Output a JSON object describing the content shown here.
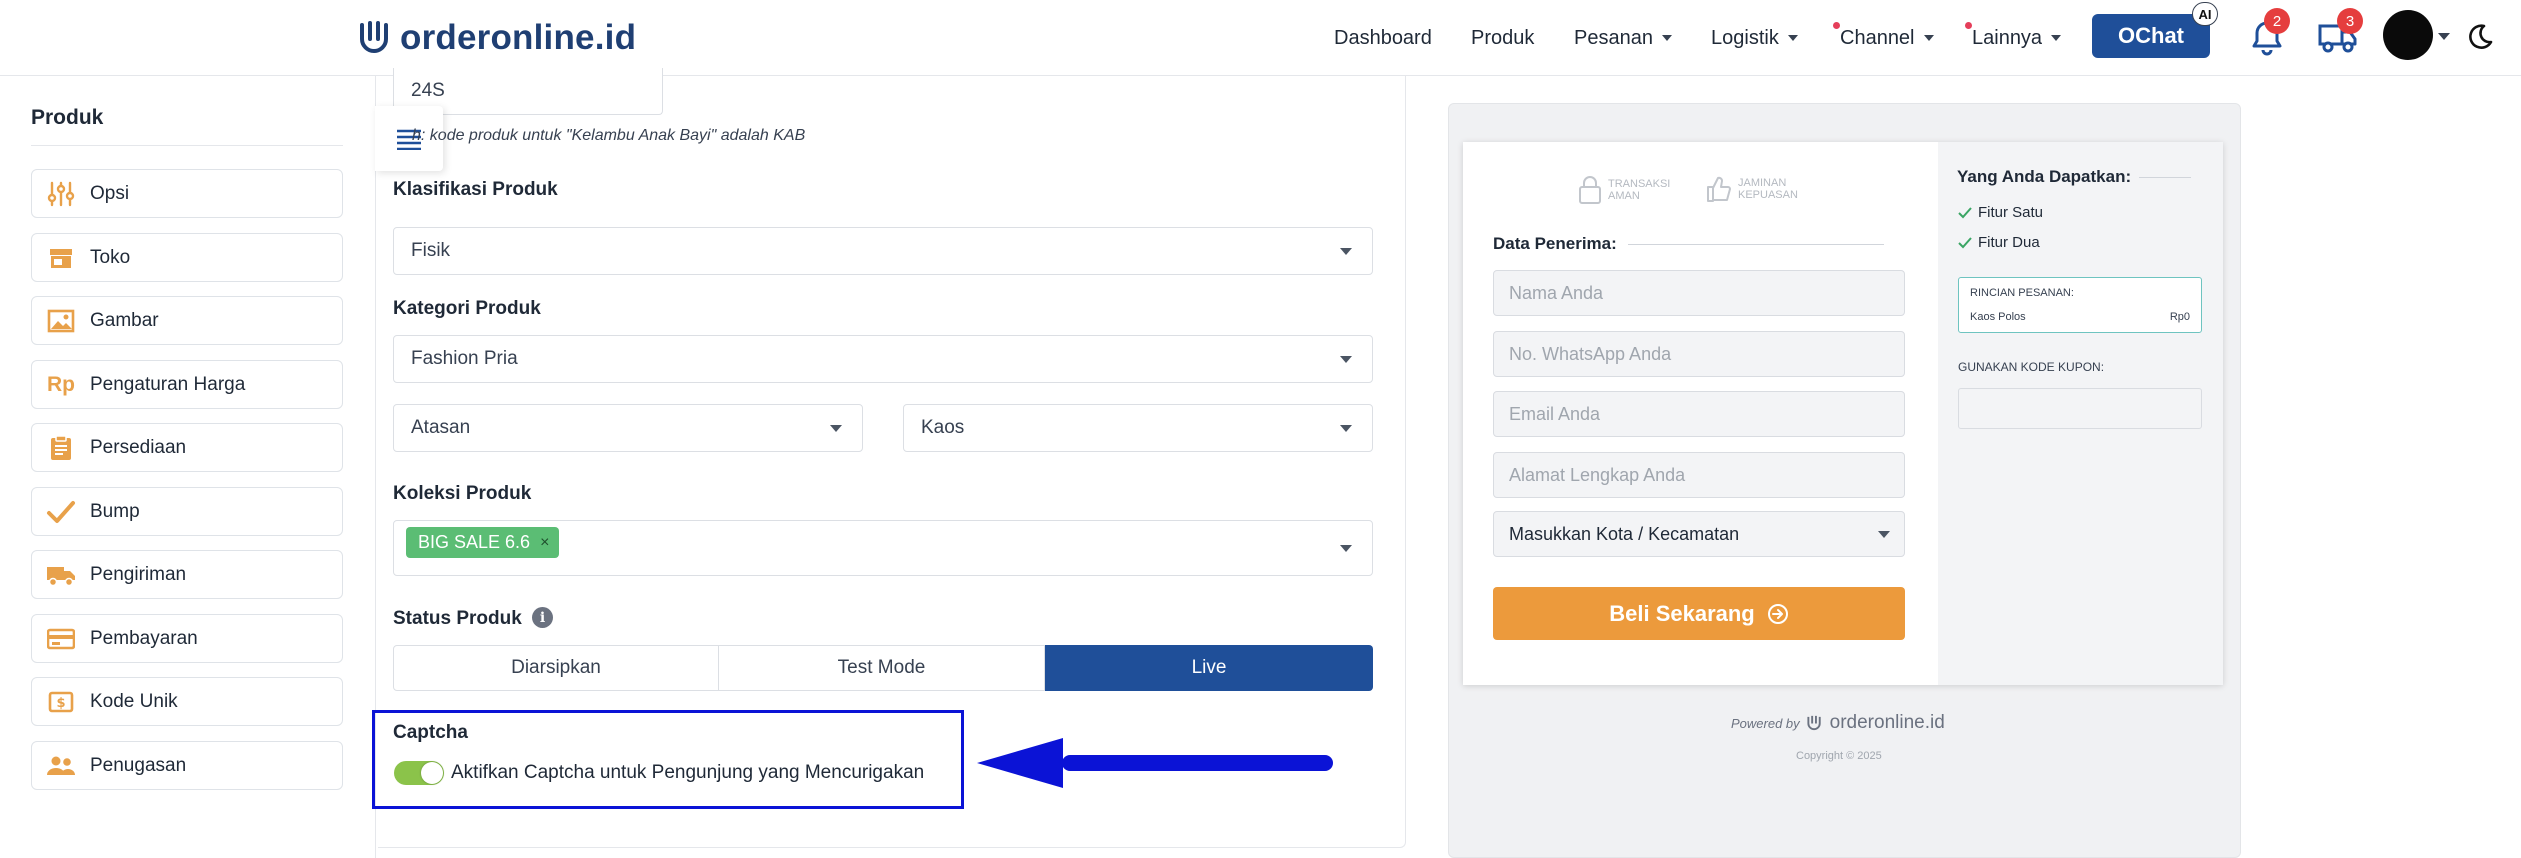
{
  "header": {
    "logo_text": "orderonline.id",
    "nav": [
      "Dashboard",
      "Produk",
      "Pesanan",
      "Logistik",
      "Channel",
      "Lainnya"
    ],
    "ochat_label": "OChat",
    "ai_label": "AI",
    "notif_count": "2",
    "shipping_count": "3"
  },
  "sidebar": {
    "title": "Produk",
    "items": [
      {
        "label": "Opsi",
        "icon": "sliders-icon"
      },
      {
        "label": "Toko",
        "icon": "store-icon"
      },
      {
        "label": "Gambar",
        "icon": "image-icon"
      },
      {
        "label": "Pengaturan Harga",
        "icon": "rp-icon"
      },
      {
        "label": "Persediaan",
        "icon": "clipboard-icon"
      },
      {
        "label": "Bump",
        "icon": "check-icon"
      },
      {
        "label": "Pengiriman",
        "icon": "truck-icon"
      },
      {
        "label": "Pembayaran",
        "icon": "card-icon"
      },
      {
        "label": "Kode Unik",
        "icon": "dollar-box-icon"
      },
      {
        "label": "Penugasan",
        "icon": "users-icon"
      }
    ]
  },
  "form": {
    "code_value": "24S",
    "code_hint": "h: kode produk untuk \"Kelambu Anak Bayi\" adalah KAB",
    "klasifikasi_label": "Klasifikasi Produk",
    "klasifikasi_value": "Fisik",
    "kategori_label": "Kategori Produk",
    "kategori_value": "Fashion Pria",
    "sub1_value": "Atasan",
    "sub2_value": "Kaos",
    "koleksi_label": "Koleksi Produk",
    "koleksi_tag": "BIG SALE 6.6",
    "tag_remove": "×",
    "status_label": "Status Produk",
    "status_options": [
      "Diarsipkan",
      "Test Mode",
      "Live"
    ],
    "status_selected": "Live",
    "captcha_title": "Captcha",
    "captcha_toggle_label": "Aktifkan Captcha untuk Pengunjung yang Mencurigakan",
    "captcha_enabled": true
  },
  "preview": {
    "trust_1": [
      "TRANSAKSI",
      "AMAN"
    ],
    "trust_2": [
      "JAMINAN",
      "KEPUASAN"
    ],
    "recipient_title": "Data Penerima:",
    "placeholders": [
      "Nama Anda",
      "No. WhatsApp Anda",
      "Email Anda",
      "Alamat Lengkap Anda"
    ],
    "city_select": "Masukkan Kota / Kecamatan",
    "buy_label": "Beli Sekarang",
    "benefits_title": "Yang Anda Dapatkan:",
    "benefits": [
      "Fitur Satu",
      "Fitur Dua"
    ],
    "order_title": "RINCIAN PESANAN:",
    "order_item": "Kaos Polos",
    "order_price": "Rp0",
    "coupon_label": "GUNAKAN KODE KUPON:",
    "powered_by": "Powered by",
    "powered_brand": "orderonline.id",
    "copyright": "Copyright © 2025"
  },
  "colors": {
    "brand_blue": "#1f4f99",
    "live_blue": "#1f4f99",
    "tag_green": "#5bbd74",
    "buy_orange": "#ec9a3c",
    "sidebar_icon": "#e8a14a",
    "annotation_blue": "#0b13d6"
  }
}
